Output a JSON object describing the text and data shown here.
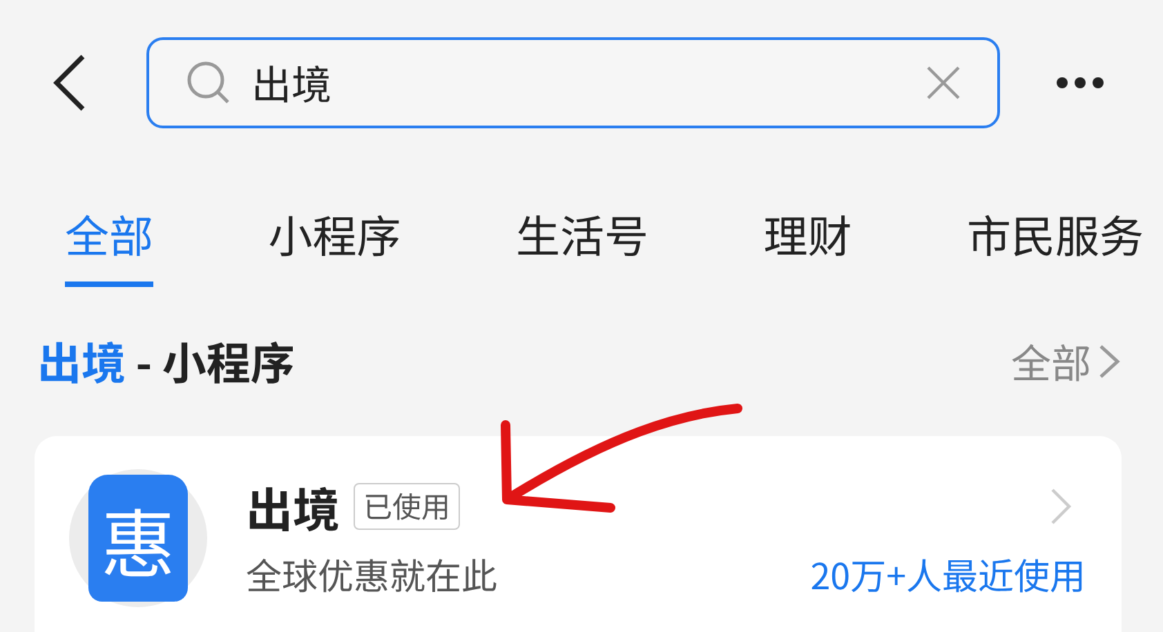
{
  "search": {
    "value": "出境"
  },
  "tabs": [
    {
      "label": "全部",
      "selected": true
    },
    {
      "label": "小程序",
      "selected": false
    },
    {
      "label": "生活号",
      "selected": false
    },
    {
      "label": "理财",
      "selected": false
    },
    {
      "label": "市民服务",
      "selected": false
    }
  ],
  "section": {
    "query": "出境",
    "title": " - 小程序",
    "more": "全部"
  },
  "result": {
    "icon_text": "惠",
    "name": "出境",
    "badge": "已使用",
    "description": "全球优惠就在此",
    "usage": "20万+人最近使用"
  }
}
